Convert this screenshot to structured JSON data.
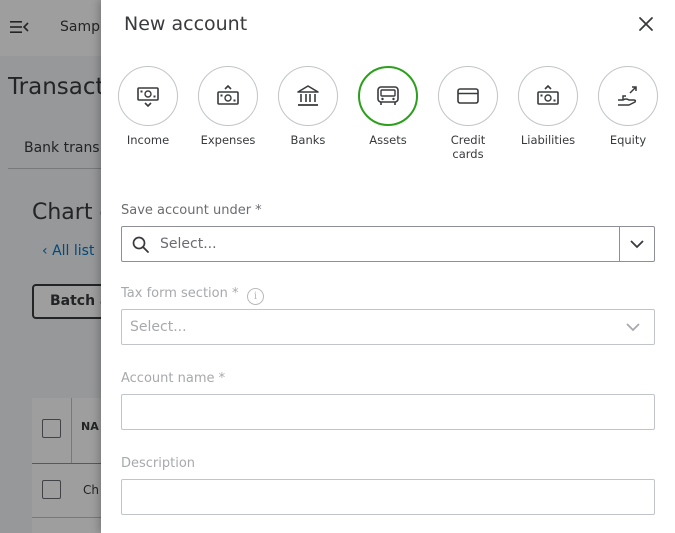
{
  "background": {
    "company_name": "Sampl",
    "page_title": "Transacti",
    "tab_label": "Bank trans",
    "section_title": "Chart o",
    "back_link": "All list",
    "batch_button": "Batch a",
    "table_header": "NA",
    "row_text": "Ch"
  },
  "panel": {
    "title": "New account",
    "account_types": [
      {
        "label_line1": "Income",
        "label_line2": "",
        "icon": "income-icon",
        "selected": false
      },
      {
        "label_line1": "Expenses",
        "label_line2": "",
        "icon": "expenses-icon",
        "selected": false
      },
      {
        "label_line1": "Banks",
        "label_line2": "",
        "icon": "bank-icon",
        "selected": false
      },
      {
        "label_line1": "Assets",
        "label_line2": "",
        "icon": "assets-icon",
        "selected": true
      },
      {
        "label_line1": "Credit",
        "label_line2": "cards",
        "icon": "credit-card-icon",
        "selected": false
      },
      {
        "label_line1": "Liabilities",
        "label_line2": "",
        "icon": "liabilities-icon",
        "selected": false
      },
      {
        "label_line1": "Equity",
        "label_line2": "",
        "icon": "equity-icon",
        "selected": false
      }
    ],
    "save_under": {
      "label": "Save account under *",
      "placeholder": "Select..."
    },
    "tax_form": {
      "label": "Tax form section *",
      "placeholder": "Select..."
    },
    "account_name": {
      "label": "Account name *",
      "value": ""
    },
    "description": {
      "label": "Description",
      "value": ""
    }
  },
  "colors": {
    "selected_accent": "#2ca01c",
    "text": "#393a3d",
    "overlay": "rgba(0,0,0,0.38)"
  }
}
